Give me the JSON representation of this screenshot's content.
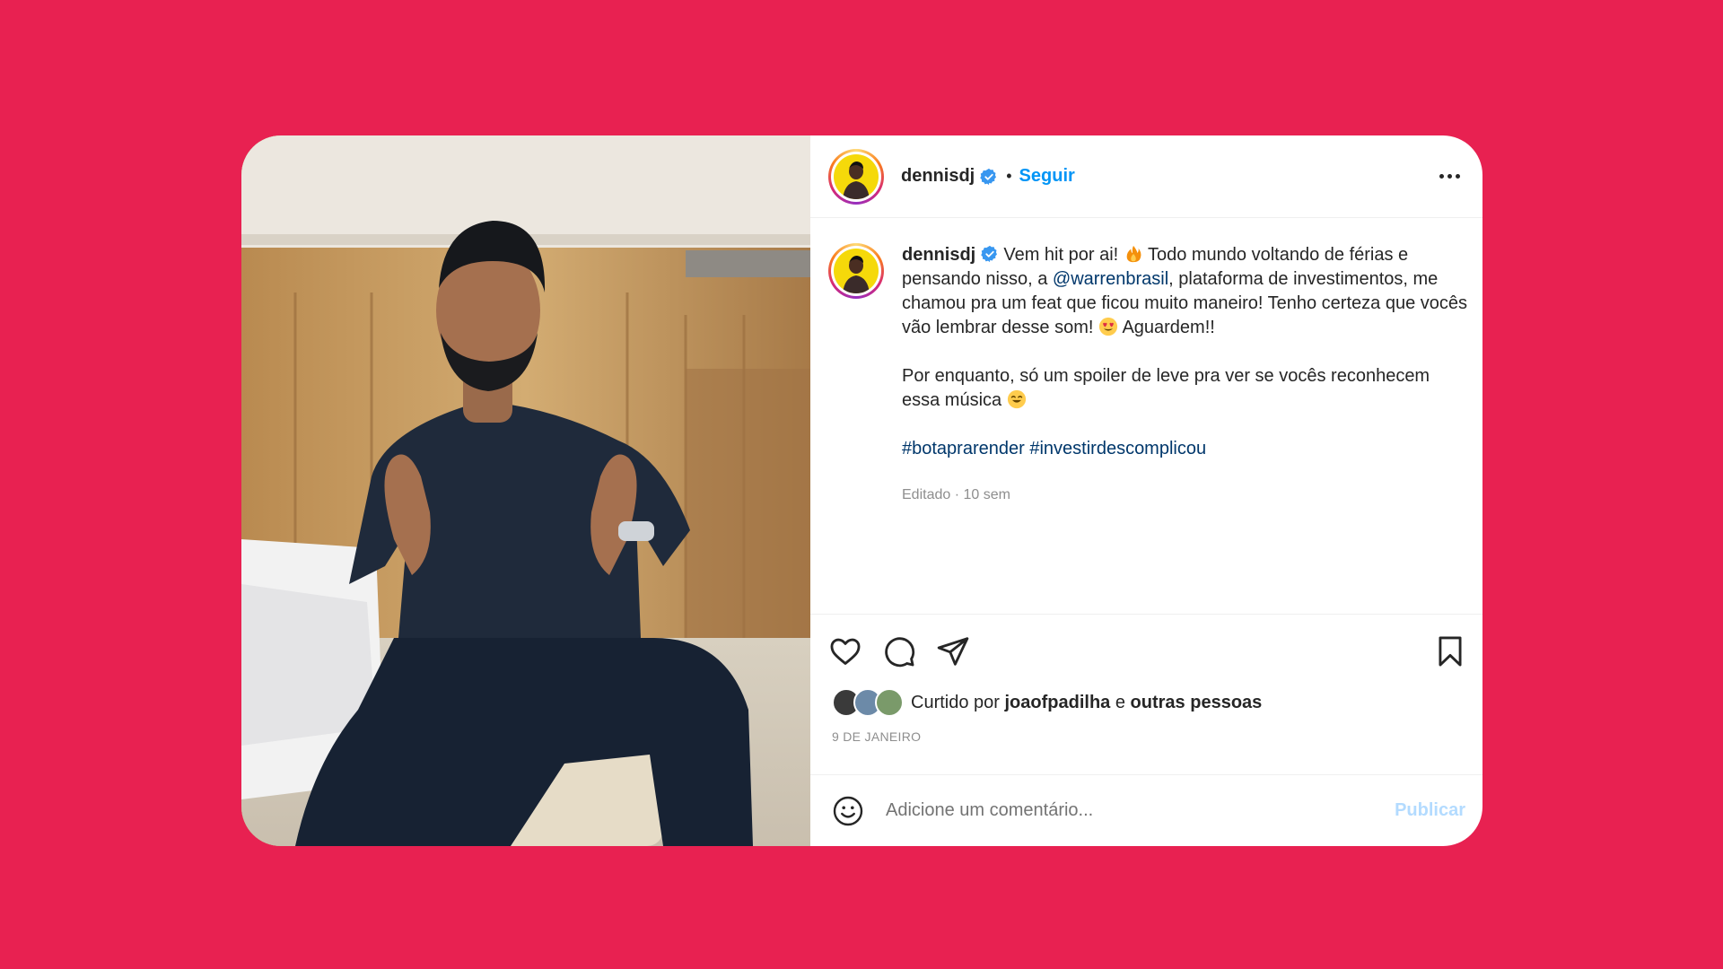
{
  "post": {
    "username": "dennisdj",
    "follow_label": "Seguir",
    "dot": "•",
    "more_icon": "more-horizontal-icon",
    "caption": {
      "username": "dennisdj",
      "p1_a": "Vem hit por ai!",
      "p1_b": "Todo mundo voltando de férias e pensando nisso, a",
      "mention": "@warrenbrasil",
      "p1_c": ", plataforma de investimentos, me chamou pra um feat que ficou muito maneiro! Tenho certeza que vocês vão lembrar desse som!",
      "p1_d": "Aguardem!!",
      "p2_a": "Por enquanto, só um spoiler de leve pra ver se vocês reconhecem essa música",
      "hashtag1": "#botaprarender",
      "hashtag2": "#investirdescomplicou"
    },
    "meta": {
      "edited": "Editado",
      "sep": " · ",
      "time": "10 sem"
    },
    "likes": {
      "prefix": "Curtido por",
      "user": "joaofpadilha",
      "joiner": "e",
      "others": "outras pessoas"
    },
    "date": "9 DE JANEIRO",
    "comment": {
      "placeholder": "Adicione um comentário...",
      "publish_label": "Publicar"
    }
  },
  "icons": {
    "verified": "verified-badge-icon",
    "fire": "fire-emoji-icon",
    "heart_eyes": "heart-eyes-emoji-icon",
    "grin": "smiling-emoji-icon",
    "like": "heart-icon",
    "comment": "comment-icon",
    "share": "paper-plane-icon",
    "save": "bookmark-icon",
    "emoji": "smiley-icon"
  },
  "colors": {
    "background": "#E82151",
    "link": "#0095F6",
    "mention": "#00376B",
    "publish_disabled": "#b3dbff"
  }
}
